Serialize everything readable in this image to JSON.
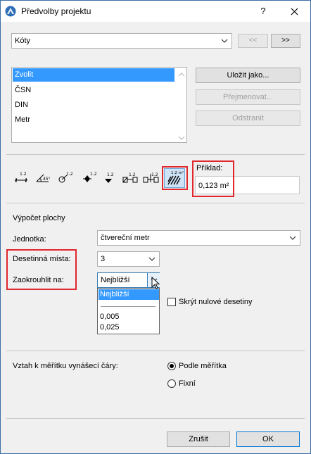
{
  "window": {
    "title": "Předvolby projektu",
    "help_label": "?",
    "close_label": "✕"
  },
  "preset": {
    "value": "Kóty",
    "prev_label": "<<",
    "next_label": ">>"
  },
  "standards": {
    "items": [
      "Zvolit",
      "ČSN",
      "DIN",
      "Metr"
    ],
    "selected_index": 0,
    "save_as_label": "Uložit jako...",
    "rename_label": "Přejmenovat...",
    "delete_label": "Odstranit"
  },
  "format_icons": [
    {
      "name": "linear-dimension-icon",
      "text": "1.2"
    },
    {
      "name": "angle-dimension-icon",
      "text": "45°"
    },
    {
      "name": "radius-dimension-icon",
      "text": "1.2"
    },
    {
      "name": "level-dimension-icon",
      "text": "1.2"
    },
    {
      "name": "elevation-marker-icon",
      "text": "1.2"
    },
    {
      "name": "door-window-dimension-icon",
      "text": "1.2"
    },
    {
      "name": "sill-height-icon",
      "text": "1.2"
    },
    {
      "name": "area-calculation-icon",
      "text": "1.2 m²"
    }
  ],
  "example": {
    "label": "Příklad:",
    "value": "0,123 m²"
  },
  "area": {
    "section_title": "Výpočet plochy",
    "unit_label": "Jednotka:",
    "unit_value": "čtvereční metr",
    "decimals_label": "Desetinná místa:",
    "decimals_value": "3",
    "round_label": "Zaokrouhlit na:",
    "round_value": "Nejbližší",
    "round_options": [
      "Nejbližší",
      "",
      "0,005",
      "0,025"
    ],
    "hide_zero_label": "Skrýt nulové desetiny"
  },
  "scale": {
    "label": "Vztah k měřítku vynášecí čáry:",
    "options": [
      "Podle měřítka",
      "Fixní"
    ],
    "selected_index": 0
  },
  "footer": {
    "cancel_label": "Zrušit",
    "ok_label": "OK"
  },
  "colors": {
    "highlight": "#e0282e",
    "selection": "#3399ff",
    "accent": "#3a6ea5"
  }
}
